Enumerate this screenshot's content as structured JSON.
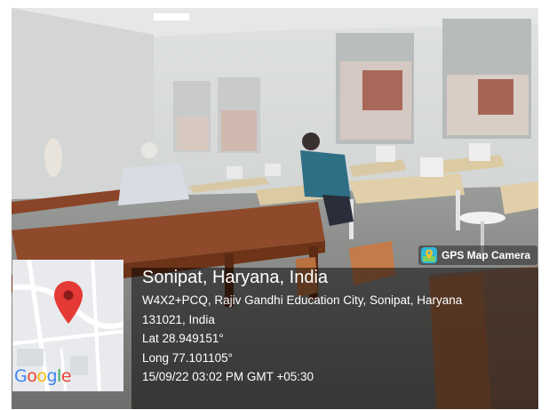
{
  "overlay": {
    "badge": {
      "label": "GPS Map Camera",
      "icon": "gps-map-camera-icon"
    },
    "map": {
      "logo_letters": [
        {
          "char": "G",
          "color": "#4285F4"
        },
        {
          "char": "o",
          "color": "#EA4335"
        },
        {
          "char": "o",
          "color": "#FBBC05"
        },
        {
          "char": "g",
          "color": "#4285F4"
        },
        {
          "char": "l",
          "color": "#34A853"
        },
        {
          "char": "e",
          "color": "#EA4335"
        }
      ],
      "pin_color": "#E53935"
    },
    "location": {
      "title": "Sonipat, Haryana, India",
      "address_line1": "W4X2+PCQ, Rajiv Gandhi Education City, Sonipat, Haryana",
      "address_line2": "131021, India",
      "lat": "Lat 28.949151°",
      "long": "Long 77.101105°",
      "datetime": "15/09/22 03:02 PM GMT +05:30"
    }
  }
}
